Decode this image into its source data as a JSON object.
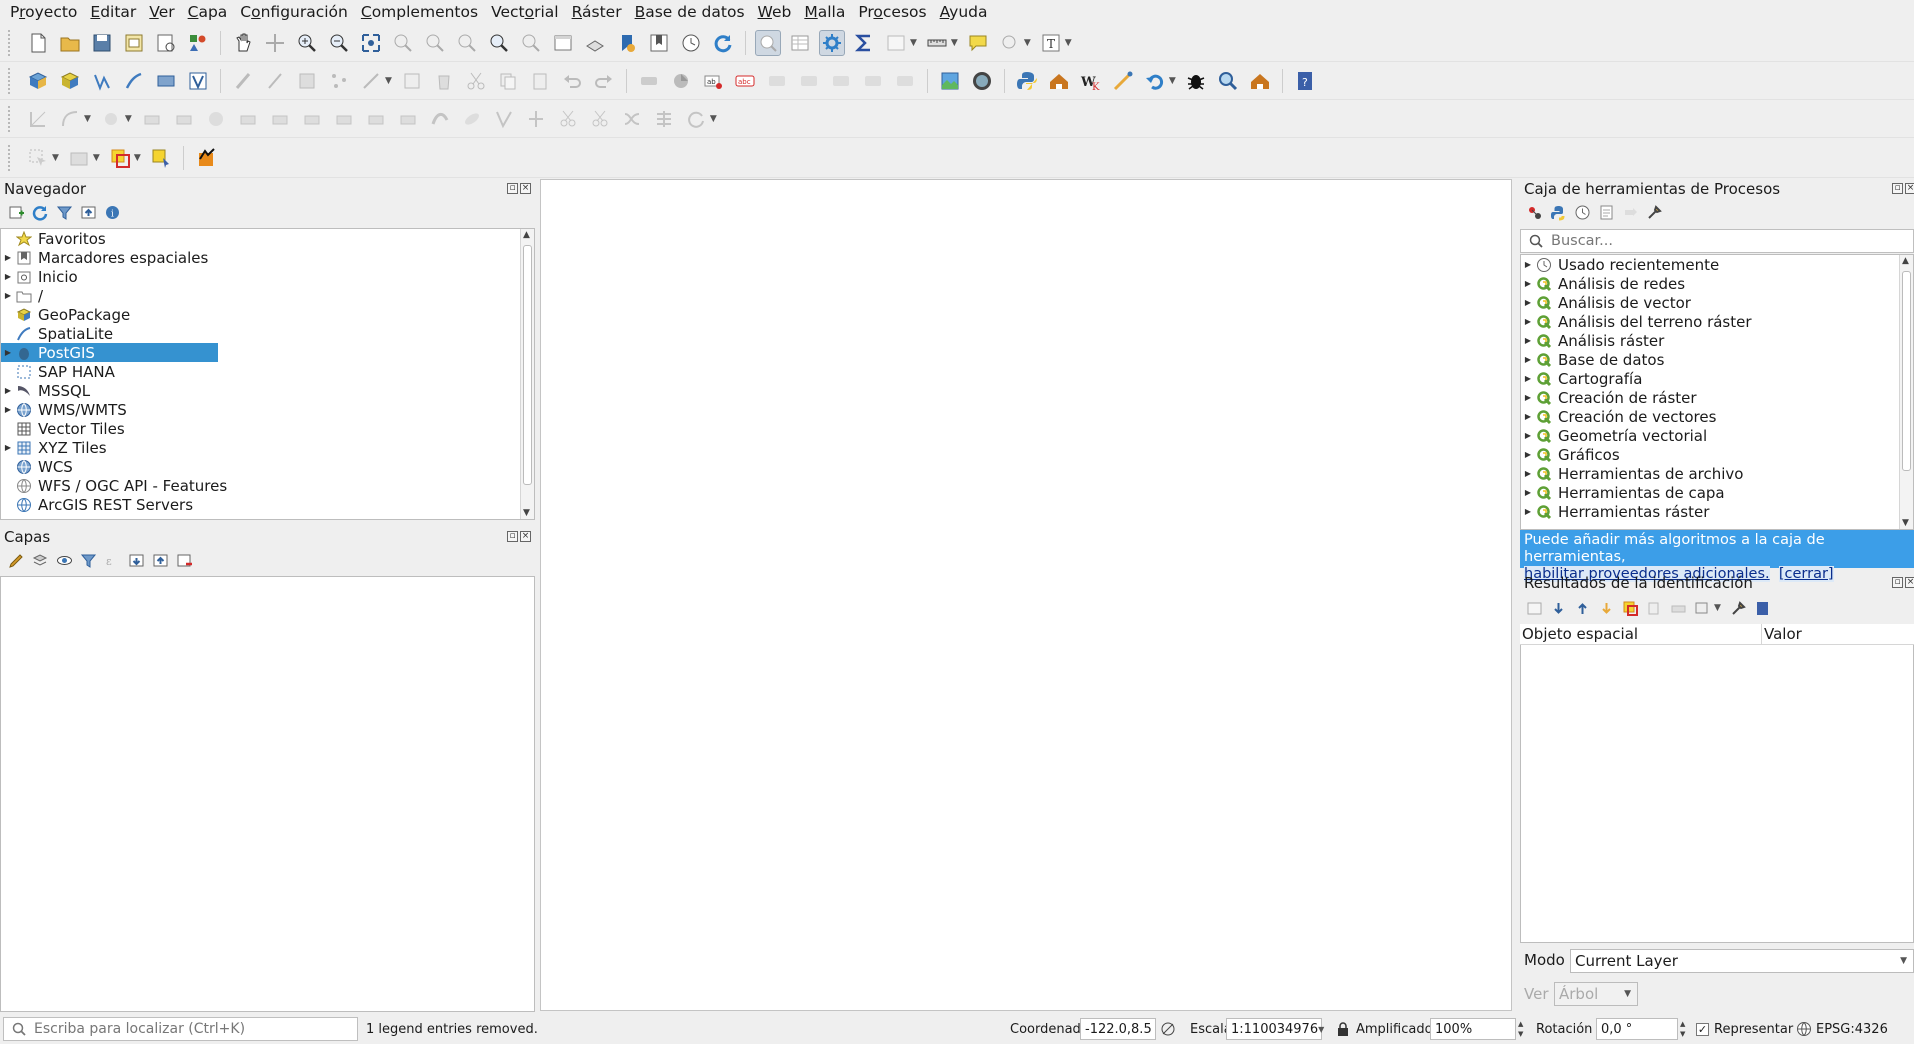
{
  "menubar": {
    "items": [
      {
        "pre": "P",
        "ul": "r",
        "post": "oyecto"
      },
      {
        "pre": "",
        "ul": "E",
        "post": "ditar"
      },
      {
        "pre": "",
        "ul": "V",
        "post": "er"
      },
      {
        "pre": "",
        "ul": "C",
        "post": "apa"
      },
      {
        "pre": "C",
        "ul": "o",
        "post": "nfiguración"
      },
      {
        "pre": "",
        "ul": "C",
        "post": "omplementos"
      },
      {
        "pre": "Vect",
        "ul": "o",
        "post": "rial"
      },
      {
        "pre": "",
        "ul": "R",
        "post": "áster"
      },
      {
        "pre": "",
        "ul": "B",
        "post": "ase de datos"
      },
      {
        "pre": "",
        "ul": "W",
        "post": "eb"
      },
      {
        "pre": "",
        "ul": "M",
        "post": "alla"
      },
      {
        "pre": "Pr",
        "ul": "o",
        "post": "cesos"
      },
      {
        "pre": "",
        "ul": "A",
        "post": "yuda"
      }
    ]
  },
  "browser": {
    "title": "Navegador",
    "items": [
      {
        "label": "Favoritos",
        "icon": "star-icon",
        "expand": false
      },
      {
        "label": "Marcadores espaciales",
        "icon": "bookmark-icon",
        "expand": true
      },
      {
        "label": "Inicio",
        "icon": "home-folder-icon",
        "expand": true
      },
      {
        "label": "/",
        "icon": "folder-icon",
        "expand": true
      },
      {
        "label": "GeoPackage",
        "icon": "geopackage-icon",
        "expand": false
      },
      {
        "label": "SpatiaLite",
        "icon": "spatialite-icon",
        "expand": false
      },
      {
        "label": "PostGIS",
        "icon": "postgis-icon",
        "expand": true,
        "selected": true
      },
      {
        "label": "SAP HANA",
        "icon": "sap-hana-icon",
        "expand": false
      },
      {
        "label": "MSSQL",
        "icon": "mssql-icon",
        "expand": true
      },
      {
        "label": "WMS/WMTS",
        "icon": "wms-icon",
        "expand": true
      },
      {
        "label": "Vector Tiles",
        "icon": "vector-tiles-icon",
        "expand": false
      },
      {
        "label": "XYZ Tiles",
        "icon": "xyz-tiles-icon",
        "expand": true
      },
      {
        "label": "WCS",
        "icon": "wcs-icon",
        "expand": false
      },
      {
        "label": "WFS / OGC API - Features",
        "icon": "wfs-icon",
        "expand": false
      },
      {
        "label": "ArcGIS REST Servers",
        "icon": "arcgis-icon",
        "expand": false
      }
    ]
  },
  "layers": {
    "title": "Capas"
  },
  "processing": {
    "title": "Caja de herramientas de Procesos",
    "search_placeholder": "Buscar...",
    "items": [
      {
        "label": "Usado recientemente",
        "icon": "clock-icon"
      },
      {
        "label": "Análisis de redes",
        "icon": "qgis-icon"
      },
      {
        "label": "Análisis de vector",
        "icon": "qgis-icon"
      },
      {
        "label": "Análisis del terreno ráster",
        "icon": "qgis-icon"
      },
      {
        "label": "Análisis ráster",
        "icon": "qgis-icon"
      },
      {
        "label": "Base de datos",
        "icon": "qgis-icon"
      },
      {
        "label": "Cartografía",
        "icon": "qgis-icon"
      },
      {
        "label": "Creación de ráster",
        "icon": "qgis-icon"
      },
      {
        "label": "Creación de vectores",
        "icon": "qgis-icon"
      },
      {
        "label": "Geometría vectorial",
        "icon": "qgis-icon"
      },
      {
        "label": "Gráficos",
        "icon": "qgis-icon"
      },
      {
        "label": "Herramientas de archivo",
        "icon": "qgis-icon"
      },
      {
        "label": "Herramientas de capa",
        "icon": "qgis-icon"
      },
      {
        "label": "Herramientas ráster",
        "icon": "qgis-icon"
      }
    ],
    "info_text": "Puede añadir más algoritmos a la caja de herramientas,",
    "info_link": "habilitar proveedores adicionales.",
    "info_close": "[cerrar]"
  },
  "identify": {
    "title": "Resultados de la identificación",
    "col_feature": "Objeto espacial",
    "col_value": "Valor",
    "mode_label": "Modo",
    "mode_value": "Current Layer",
    "view_label": "Ver",
    "view_value": "Árbol"
  },
  "statusbar": {
    "locator_placeholder": "Escriba para localizar (Ctrl+K)",
    "message": "1 legend entries removed.",
    "coord_label": "Coordenada",
    "coord_value": "-122.0,8.5",
    "scale_label": "Escala",
    "scale_value": "1:110034976",
    "magnifier_label": "Amplificador",
    "magnifier_value": "100%",
    "rotation_label": "Rotación",
    "rotation_value": "0,0 °",
    "render_label": "Representar",
    "crs": "EPSG:4326"
  }
}
